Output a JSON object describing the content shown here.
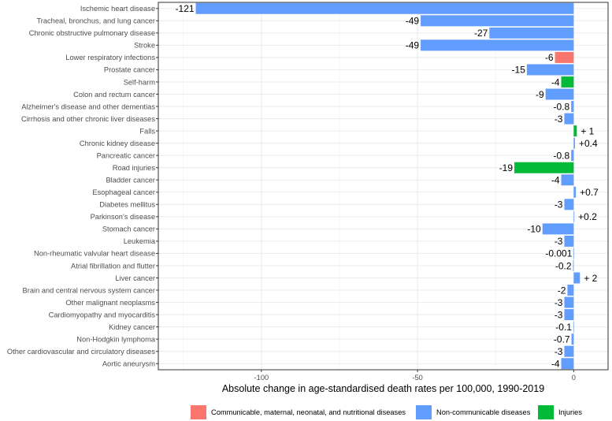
{
  "chart_data": {
    "type": "bar",
    "orientation": "horizontal",
    "xlabel": "Absolute change in age-standardised death rates per 100,000, 1990-2019",
    "xlim": [
      -133,
      11
    ],
    "x_ticks": [
      -100,
      -50,
      0
    ],
    "x_tick_labels": [
      "-100",
      "-50",
      "0"
    ],
    "grid": true,
    "legend_position": "bottom",
    "colors": {
      "communicable": "#F8766D",
      "ncd": "#619CFF",
      "injuries": "#00BA38"
    },
    "legend": [
      {
        "key": "communicable",
        "label": "Communicable, maternal, neonatal, and nutritional diseases"
      },
      {
        "key": "ncd",
        "label": "Non-communicable diseases"
      },
      {
        "key": "injuries",
        "label": "Injuries"
      }
    ],
    "bars": [
      {
        "category": "Ischemic heart disease",
        "value": -121,
        "label": "-121",
        "group": "ncd"
      },
      {
        "category": "Tracheal, bronchus, and lung cancer",
        "value": -49,
        "label": "-49",
        "group": "ncd"
      },
      {
        "category": "Chronic obstructive pulmonary disease",
        "value": -27,
        "label": "-27",
        "group": "ncd"
      },
      {
        "category": "Stroke",
        "value": -49,
        "label": "-49",
        "group": "ncd"
      },
      {
        "category": "Lower respiratory infections",
        "value": -6,
        "label": "-6",
        "group": "communicable"
      },
      {
        "category": "Prostate cancer",
        "value": -15,
        "label": "-15",
        "group": "ncd"
      },
      {
        "category": "Self-harm",
        "value": -4,
        "label": "-4",
        "group": "injuries"
      },
      {
        "category": "Colon and rectum cancer",
        "value": -9,
        "label": "-9",
        "group": "ncd"
      },
      {
        "category": "Alzheimer's disease and other dementias",
        "value": -0.8,
        "label": "-0.8",
        "group": "ncd"
      },
      {
        "category": "Cirrhosis and other chronic liver diseases",
        "value": -3,
        "label": "-3",
        "group": "ncd"
      },
      {
        "category": "Falls",
        "value": 1,
        "label": "+ 1",
        "group": "injuries"
      },
      {
        "category": "Chronic kidney disease",
        "value": 0.4,
        "label": "+0.4",
        "group": "ncd"
      },
      {
        "category": "Pancreatic cancer",
        "value": -0.8,
        "label": "-0.8",
        "group": "ncd"
      },
      {
        "category": "Road injuries",
        "value": -19,
        "label": "-19",
        "group": "injuries"
      },
      {
        "category": "Bladder cancer",
        "value": -4,
        "label": "-4",
        "group": "ncd"
      },
      {
        "category": "Esophageal cancer",
        "value": 0.7,
        "label": "+0.7",
        "group": "ncd"
      },
      {
        "category": "Diabetes mellitus",
        "value": -3,
        "label": "-3",
        "group": "ncd"
      },
      {
        "category": "Parkinson's disease",
        "value": 0.2,
        "label": "+0.2",
        "group": "ncd"
      },
      {
        "category": "Stomach cancer",
        "value": -10,
        "label": "-10",
        "group": "ncd"
      },
      {
        "category": "Leukemia",
        "value": -3,
        "label": "-3",
        "group": "ncd"
      },
      {
        "category": "Non-rheumatic valvular heart disease",
        "value": -0.001,
        "label": "-0.001",
        "group": "ncd"
      },
      {
        "category": "Atrial fibrillation and flutter",
        "value": -0.2,
        "label": "-0.2",
        "group": "ncd"
      },
      {
        "category": "Liver cancer",
        "value": 2,
        "label": "+ 2",
        "group": "ncd"
      },
      {
        "category": "Brain and central nervous system cancer",
        "value": -2,
        "label": "-2",
        "group": "ncd"
      },
      {
        "category": "Other malignant neoplasms",
        "value": -3,
        "label": "-3",
        "group": "ncd"
      },
      {
        "category": "Cardiomyopathy and myocarditis",
        "value": -3,
        "label": "-3",
        "group": "ncd"
      },
      {
        "category": "Kidney cancer",
        "value": -0.1,
        "label": "-0.1",
        "group": "ncd"
      },
      {
        "category": "Non-Hodgkin lymphoma",
        "value": -0.7,
        "label": "-0.7",
        "group": "ncd"
      },
      {
        "category": "Other cardiovascular and circulatory diseases",
        "value": -3,
        "label": "-3",
        "group": "ncd"
      },
      {
        "category": "Aortic aneurysm",
        "value": -4,
        "label": "-4",
        "group": "ncd"
      }
    ]
  }
}
